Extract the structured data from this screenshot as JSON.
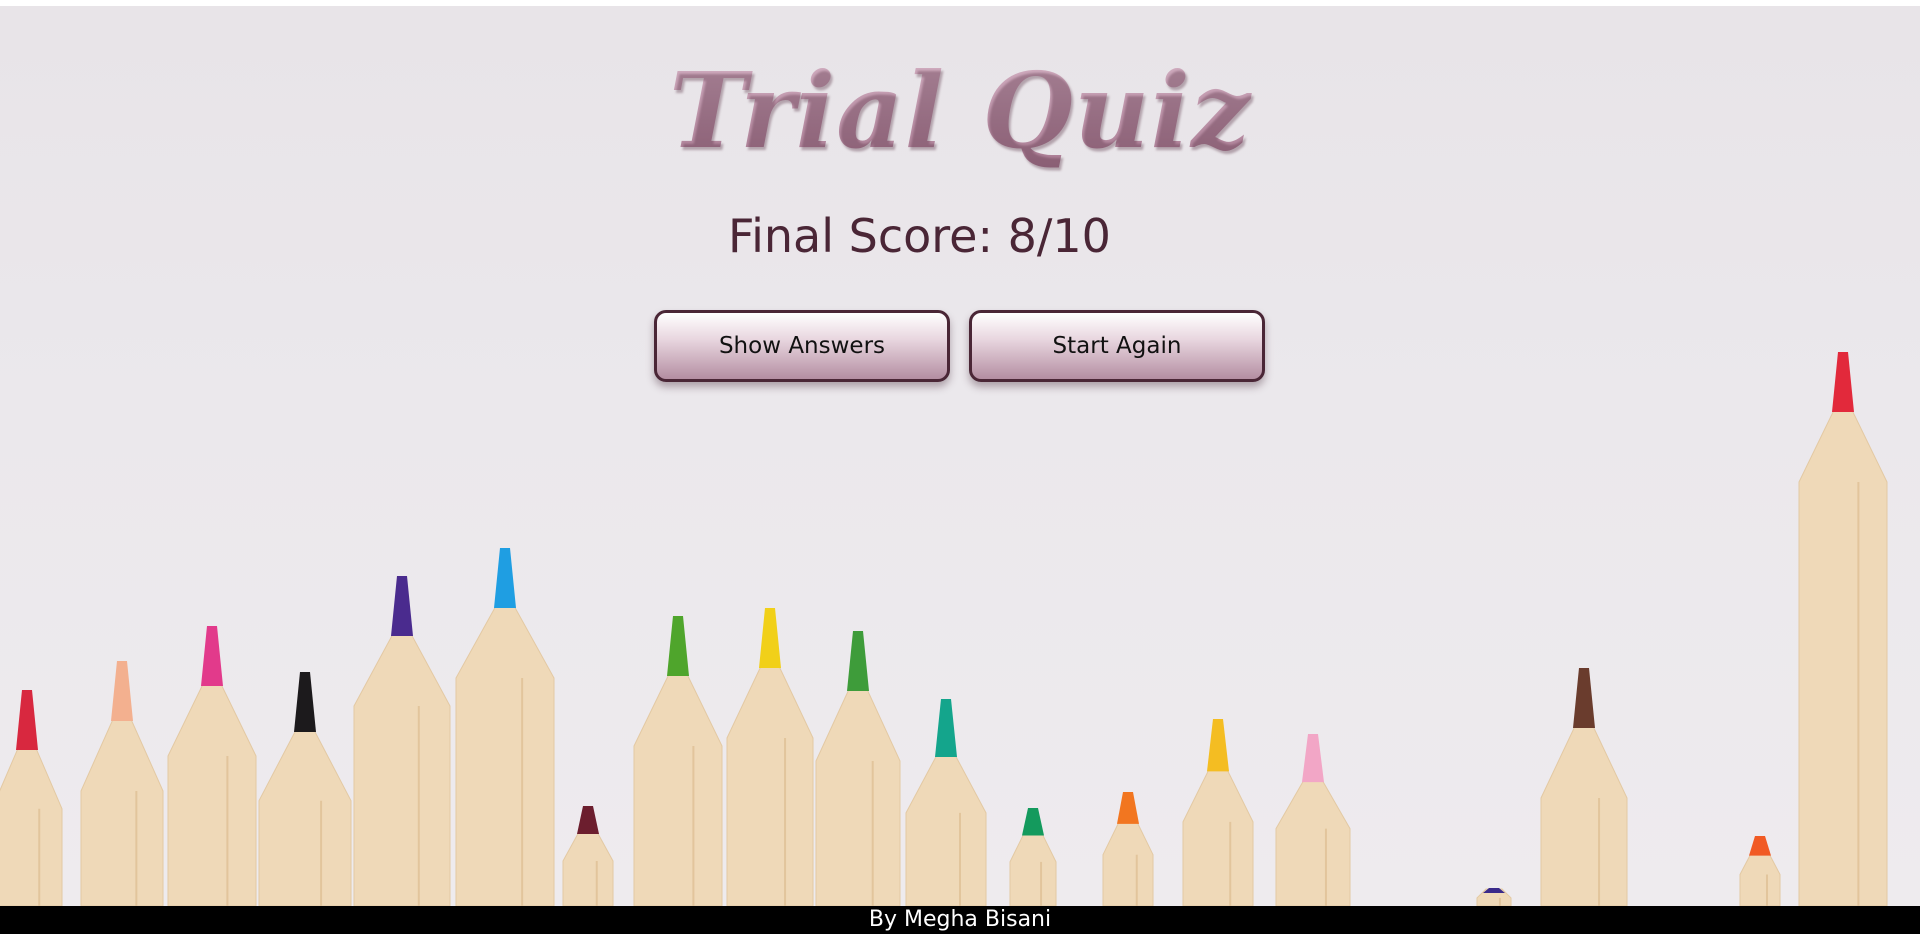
{
  "page": {
    "title": "Trial Quiz",
    "score_text": "Final Score: 8/10"
  },
  "buttons": {
    "show_answers": "Show Answers",
    "start_again": "Start Again"
  },
  "footer": {
    "credit": "By Megha Bisani"
  },
  "background": {
    "image": "colored-pencils",
    "pencil_tip_colors": [
      "#d8283f",
      "#f3b08f",
      "#e23a8b",
      "#1c1a1c",
      "#4a2b8e",
      "#1f9ee2",
      "#6c1e2e",
      "#4fa52c",
      "#f1d019",
      "#3e9c3a",
      "#14a58c",
      "#149a5d",
      "#f27620",
      "#f4bd22",
      "#f2a6c6",
      "#3a2a8a",
      "#6a3c2d",
      "#f15a24",
      "#e2293b"
    ]
  },
  "colors": {
    "title_gradient_top": "#d6b4c6",
    "title_gradient_bottom": "#a77890",
    "score_text": "#4a2636",
    "button_border": "#4a2636",
    "footer_bg": "#000000",
    "footer_text": "#ffffff"
  }
}
